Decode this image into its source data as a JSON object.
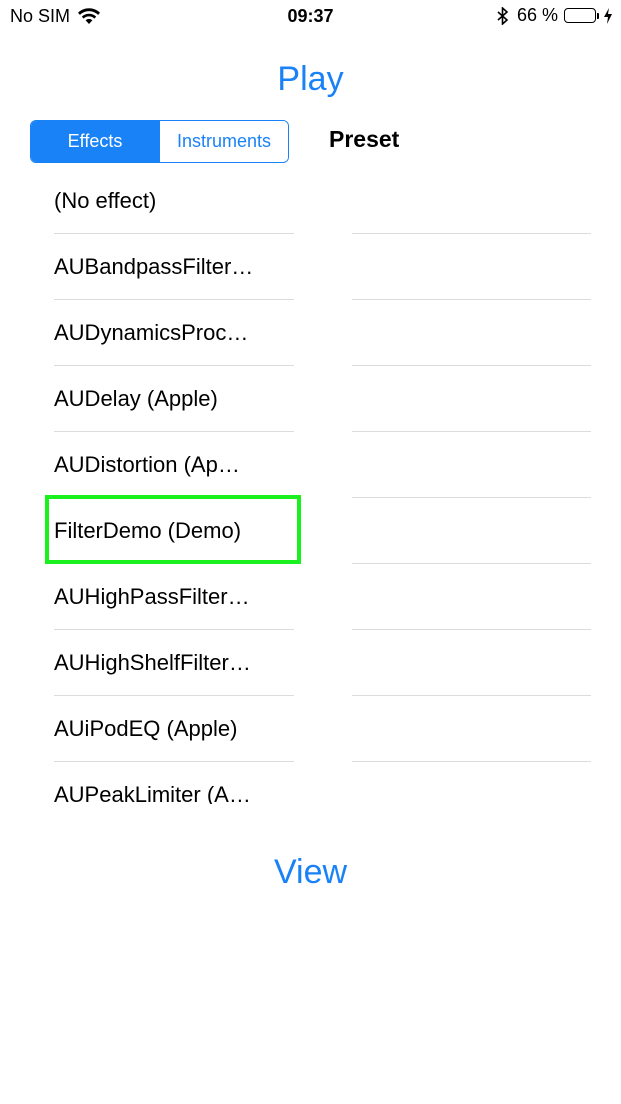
{
  "status_bar": {
    "carrier": "No SIM",
    "time": "09:37",
    "battery_percent": "66 %",
    "battery_level": 0.66,
    "icons": [
      "wifi-icon",
      "bluetooth-icon",
      "battery-icon",
      "charging-bolt-icon"
    ]
  },
  "colors": {
    "accent": "#1a82f7",
    "highlight": "#19f01e",
    "battery_fill": "#4cd964",
    "separator": "#dcdcdc"
  },
  "header": {
    "play_label": "Play"
  },
  "segmented": {
    "effects_label": "Effects",
    "instruments_label": "Instruments",
    "selected": "Effects"
  },
  "preset": {
    "title": "Preset"
  },
  "effects": {
    "items": [
      "(No effect)",
      "AUBandpassFilter…",
      "AUDynamicsProc…",
      "AUDelay (Apple)",
      "AUDistortion (Ap…",
      "FilterDemo (Demo)",
      "AUHighPassFilter…",
      "AUHighShelfFilter…",
      "AUiPodEQ (Apple)",
      "AUPeakLimiter (A…"
    ],
    "highlighted": "FilterDemo (Demo)"
  },
  "footer": {
    "view_label": "View"
  }
}
